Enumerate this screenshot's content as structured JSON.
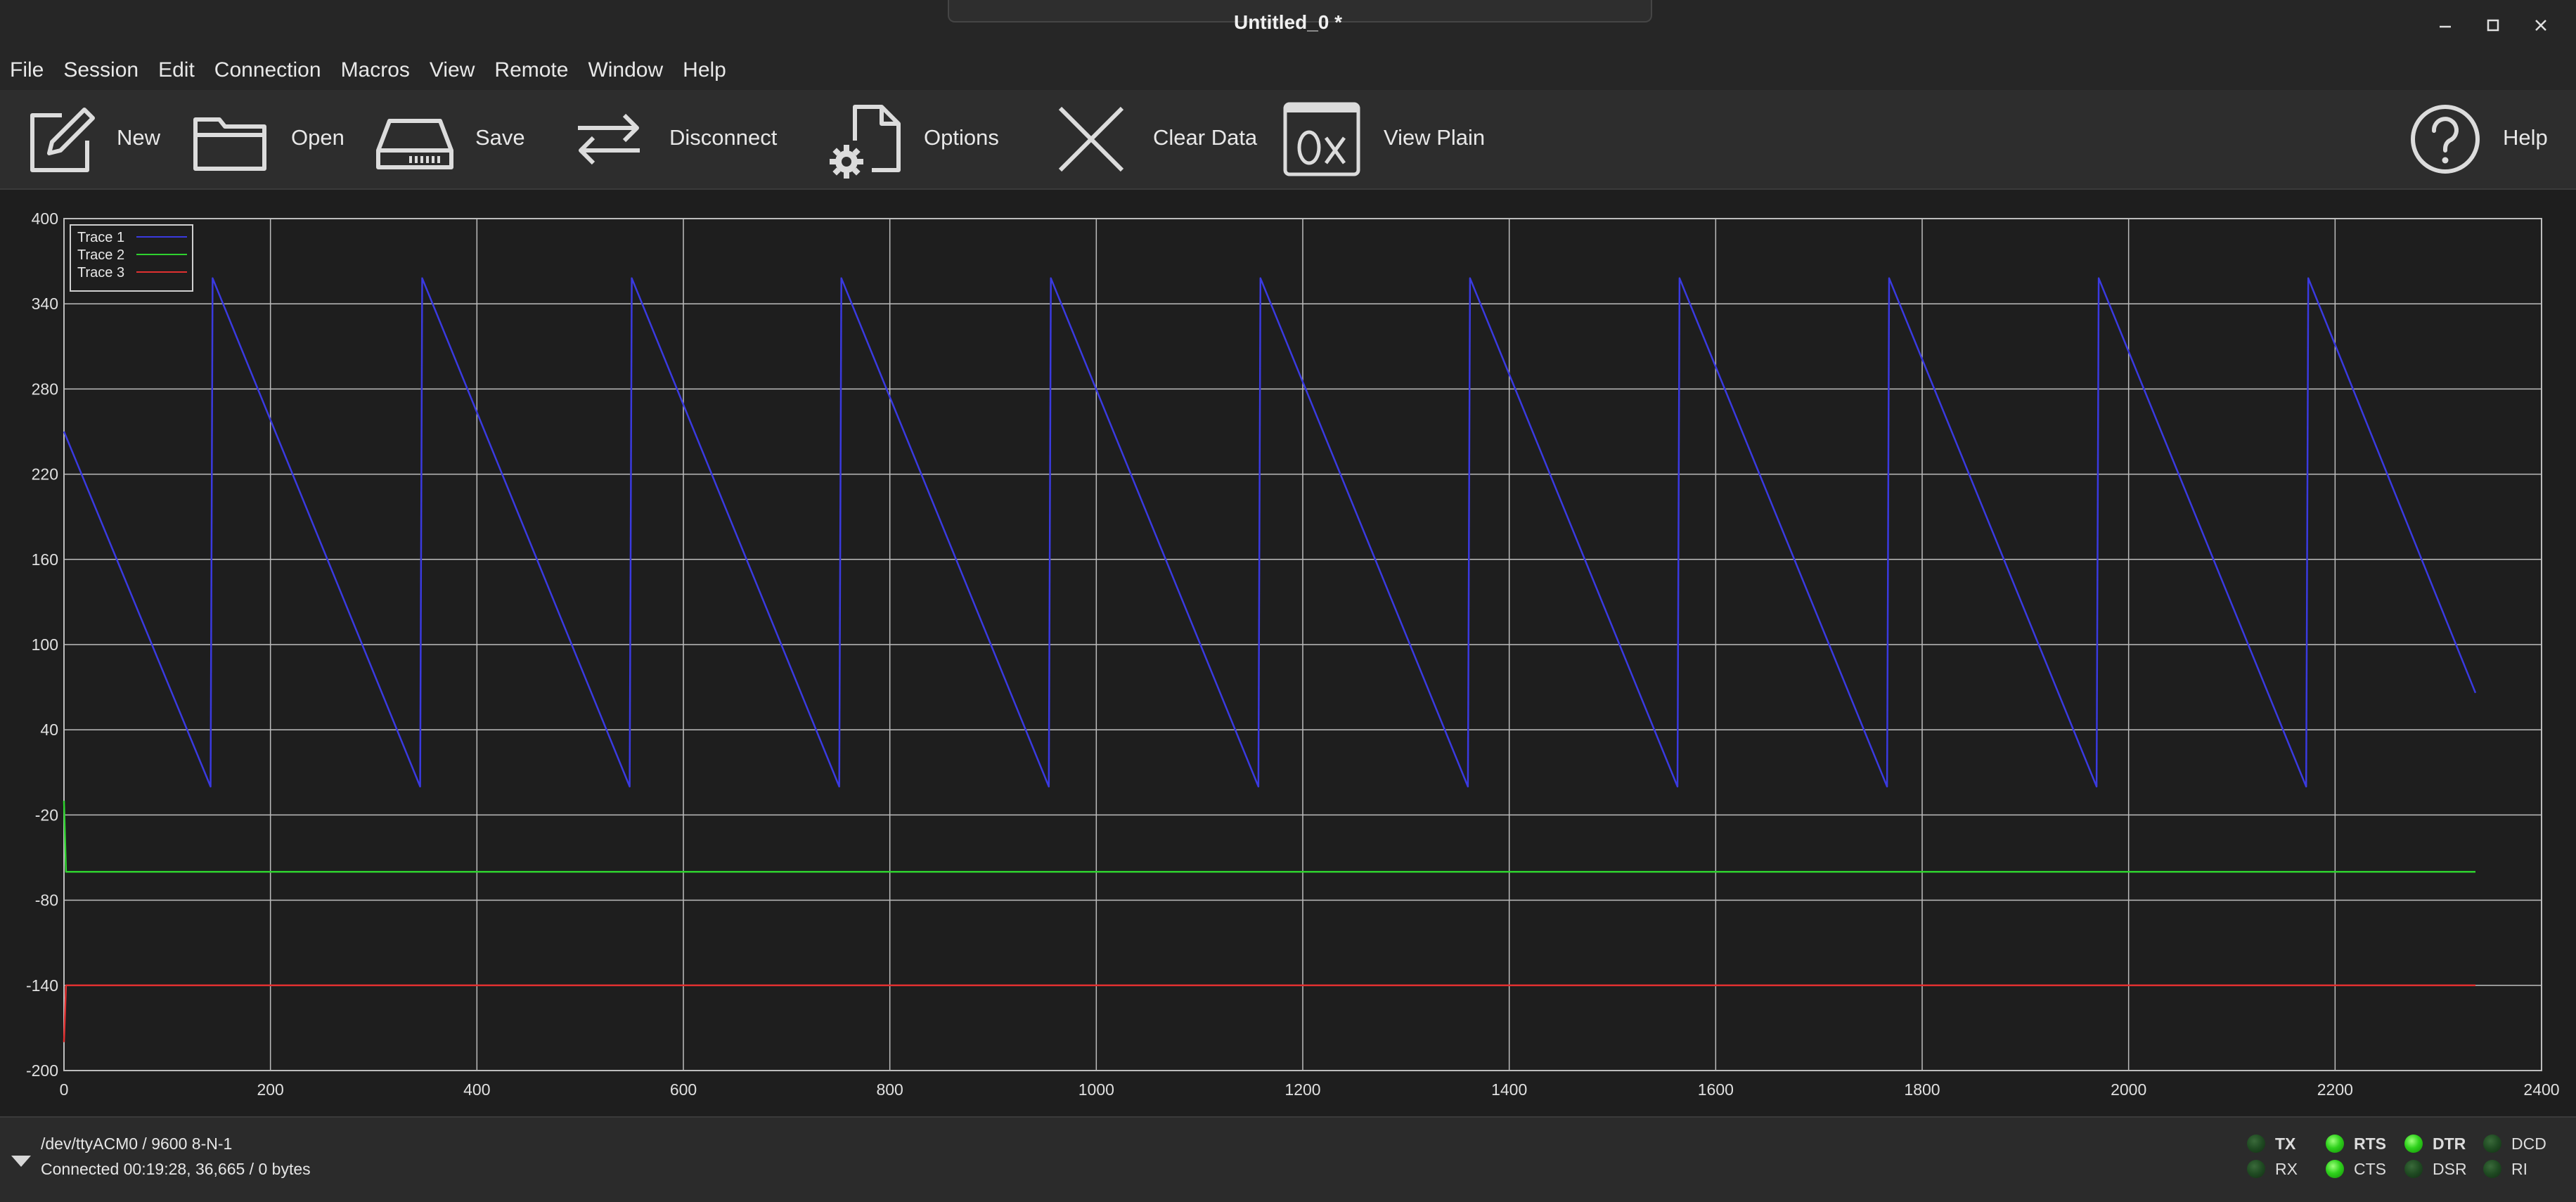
{
  "window": {
    "title": "Untitled_0 *"
  },
  "menu": [
    "File",
    "Session",
    "Edit",
    "Connection",
    "Macros",
    "View",
    "Remote",
    "Window",
    "Help"
  ],
  "toolbar": {
    "new": "New",
    "open": "Open",
    "save": "Save",
    "disconnect": "Disconnect",
    "options": "Options",
    "clear_data": "Clear Data",
    "view_plain": "View Plain",
    "help": "Help"
  },
  "colors": {
    "trace1": "#3a3ae0",
    "trace2": "#2fd22f",
    "trace3": "#e03030",
    "grid": "#bdbdbd",
    "plot_bg": "#1e1e1e"
  },
  "chart_data": {
    "type": "line",
    "xlim": [
      0,
      2400
    ],
    "ylim": [
      -200,
      400
    ],
    "x_ticks": [
      0,
      200,
      400,
      600,
      800,
      1000,
      1200,
      1400,
      1600,
      1800,
      2000,
      2200,
      2400
    ],
    "y_ticks": [
      400,
      340,
      280,
      220,
      160,
      100,
      40,
      -20,
      -80,
      -140,
      -200
    ],
    "grid": true,
    "legend_position": "top-left",
    "series": [
      {
        "name": "Trace 1",
        "x": [
          0,
          142,
          144,
          345,
          347,
          548,
          550,
          751,
          753,
          954,
          956,
          1157,
          1159,
          1360,
          1362,
          1563,
          1565,
          1766,
          1768,
          1969,
          1971,
          2172,
          2174,
          2336
        ],
        "y": [
          250,
          0,
          358,
          0,
          358,
          0,
          358,
          0,
          358,
          0,
          358,
          0,
          358,
          0,
          358,
          0,
          358,
          0,
          358,
          0,
          358,
          0,
          358,
          66
        ]
      },
      {
        "name": "Trace 2",
        "x": [
          0,
          2,
          2336
        ],
        "y": [
          -10,
          -60,
          -60
        ]
      },
      {
        "name": "Trace 3",
        "x": [
          0,
          2,
          2336
        ],
        "y": [
          -180,
          -140,
          -140
        ]
      }
    ]
  },
  "status": {
    "port": "/dev/ttyACM0 / 9600 8-N-1",
    "connection": "Connected 00:19:28, 36,665 / 0 bytes",
    "leds": [
      {
        "label": "TX",
        "on": false,
        "bold": true
      },
      {
        "label": "RX",
        "on": false,
        "bold": false
      },
      {
        "label": "RTS",
        "on": true,
        "bold": true
      },
      {
        "label": "CTS",
        "on": true,
        "bold": false
      },
      {
        "label": "DTR",
        "on": true,
        "bold": true
      },
      {
        "label": "DSR",
        "on": false,
        "bold": false
      },
      {
        "label": "DCD",
        "on": false,
        "bold": false
      },
      {
        "label": "RI",
        "on": false,
        "bold": false
      }
    ]
  }
}
